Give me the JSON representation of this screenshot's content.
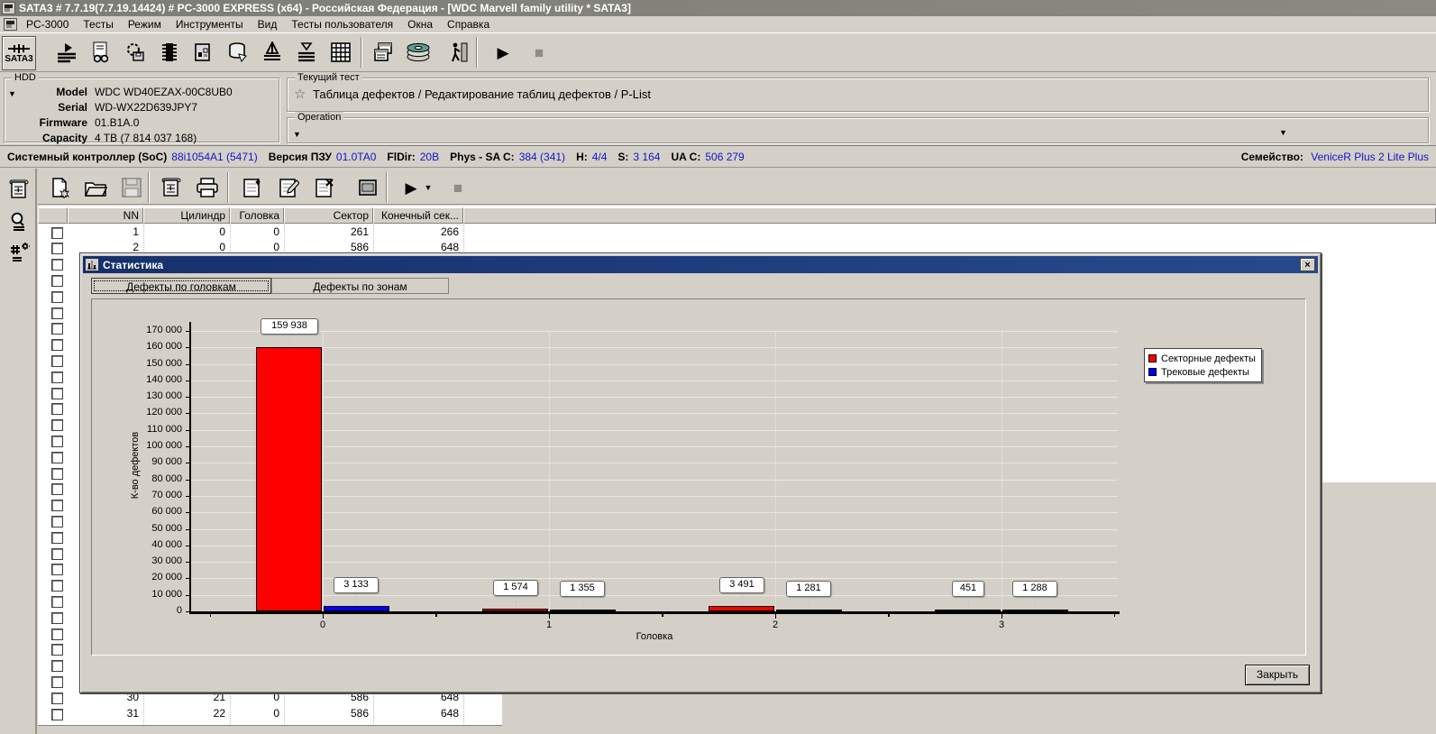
{
  "window": {
    "title": "SATA3 # 7.7.19(7.7.19.14424) # PC-3000 EXPRESS (x64) - Российская Федерация - [WDC Marvell family utility * SATA3]"
  },
  "menu": {
    "items": [
      "PC-3000",
      "Тесты",
      "Режим",
      "Инструменты",
      "Вид",
      "Тесты пользователя",
      "Окна",
      "Справка"
    ]
  },
  "toolbar": {
    "sata3_label": "SATA3"
  },
  "hdd": {
    "group_label": "HDD",
    "fields": [
      {
        "label": "Model",
        "value": "WDC WD40EZAX-00C8UB0"
      },
      {
        "label": "Serial",
        "value": "WD-WX22D639JPY7"
      },
      {
        "label": "Firmware",
        "value": "01.B1A.0"
      },
      {
        "label": "Capacity",
        "value": "4 TB (7 814 037 168)"
      }
    ]
  },
  "current_test": {
    "group_label": "Текущий тест",
    "value": "Таблица дефектов / Редактирование таблиц дефектов / P-List"
  },
  "operation": {
    "group_label": "Operation"
  },
  "soc_bar": {
    "segments": [
      {
        "label": "Системный контроллер (SoC)",
        "value": "88i1054A1 (5471)"
      },
      {
        "label": "Версия ПЗУ",
        "value": "01.0TA0"
      },
      {
        "label": "FlDir:",
        "value": "20B"
      },
      {
        "label": "Phys - SA C:",
        "value": "384 (341)"
      },
      {
        "label": "H:",
        "value": "4/4"
      },
      {
        "label": "S:",
        "value": "3 164"
      },
      {
        "label": "UA C:",
        "value": "506 279"
      }
    ],
    "family_label": "Семейство:",
    "family_value": "VeniceR Plus 2 Lite Plus"
  },
  "defect_table": {
    "columns": [
      "NN",
      "Цилиндр",
      "Головка",
      "Сектор",
      "Конечный сек..."
    ],
    "rows": [
      {
        "nn": "1",
        "cyl": "0",
        "head": "0",
        "sector": "261",
        "end_sector": "266"
      },
      {
        "nn": "2",
        "cyl": "0",
        "head": "0",
        "sector": "586",
        "end_sector": "648"
      },
      {
        "nn": "30",
        "cyl": "21",
        "head": "0",
        "sector": "586",
        "end_sector": "648"
      },
      {
        "nn": "31",
        "cyl": "22",
        "head": "0",
        "sector": "586",
        "end_sector": "648"
      }
    ]
  },
  "dialog": {
    "title": "Статистика",
    "tabs": [
      "Дефекты по головкам",
      "Дефекты по зонам"
    ],
    "close_x": "×",
    "close_button_label": "Закрыть"
  },
  "chart_data": {
    "type": "bar",
    "categories": [
      "0",
      "1",
      "2",
      "3"
    ],
    "series": [
      {
        "name": "Секторные дефекты",
        "color": "#ff0000",
        "values": [
          159938,
          1574,
          3491,
          451
        ],
        "labels": [
          "159 938",
          "1 574",
          "3 491",
          "451"
        ]
      },
      {
        "name": "Трековые дефекты",
        "color": "#0000ff",
        "values": [
          3133,
          1355,
          1281,
          1288
        ],
        "labels": [
          "3 133",
          "1 355",
          "1 281",
          "1 288"
        ]
      }
    ],
    "xlabel": "Головка",
    "ylabel": "К-во дефектов",
    "ylim": [
      0,
      170000
    ],
    "ytick_step": 10000,
    "grid": true,
    "legend_position": "right"
  }
}
